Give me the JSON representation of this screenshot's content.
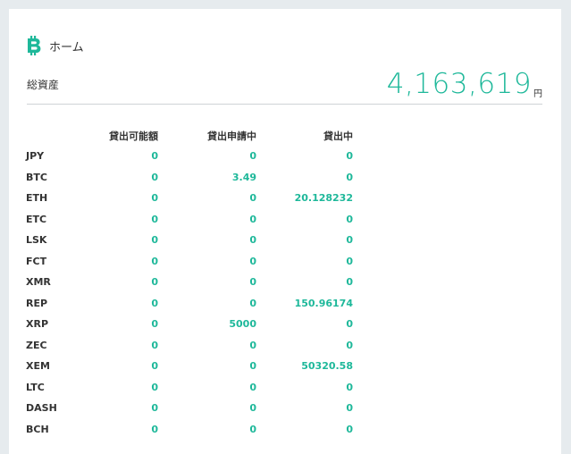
{
  "header": {
    "title": "ホーム"
  },
  "assets": {
    "label": "総資産",
    "value": "4,163,619",
    "unit": "円"
  },
  "table": {
    "columns": [
      "",
      "貸出可能額",
      "貸出申請中",
      "貸出中"
    ],
    "rows": [
      {
        "currency": "JPY",
        "available": "0",
        "requesting": "0",
        "lending": "0"
      },
      {
        "currency": "BTC",
        "available": "0",
        "requesting": "3.49",
        "lending": "0"
      },
      {
        "currency": "ETH",
        "available": "0",
        "requesting": "0",
        "lending": "20.128232"
      },
      {
        "currency": "ETC",
        "available": "0",
        "requesting": "0",
        "lending": "0"
      },
      {
        "currency": "LSK",
        "available": "0",
        "requesting": "0",
        "lending": "0"
      },
      {
        "currency": "FCT",
        "available": "0",
        "requesting": "0",
        "lending": "0"
      },
      {
        "currency": "XMR",
        "available": "0",
        "requesting": "0",
        "lending": "0"
      },
      {
        "currency": "REP",
        "available": "0",
        "requesting": "0",
        "lending": "150.96174"
      },
      {
        "currency": "XRP",
        "available": "0",
        "requesting": "5000",
        "lending": "0"
      },
      {
        "currency": "ZEC",
        "available": "0",
        "requesting": "0",
        "lending": "0"
      },
      {
        "currency": "XEM",
        "available": "0",
        "requesting": "0",
        "lending": "50320.58"
      },
      {
        "currency": "LTC",
        "available": "0",
        "requesting": "0",
        "lending": "0"
      },
      {
        "currency": "DASH",
        "available": "0",
        "requesting": "0",
        "lending": "0"
      },
      {
        "currency": "BCH",
        "available": "0",
        "requesting": "0",
        "lending": "0"
      }
    ]
  },
  "icons": {
    "header": "bitcoin-icon"
  },
  "colors": {
    "accent": "#1eb89a",
    "background": "#e6ebee",
    "card": "#ffffff",
    "text": "#333333"
  }
}
